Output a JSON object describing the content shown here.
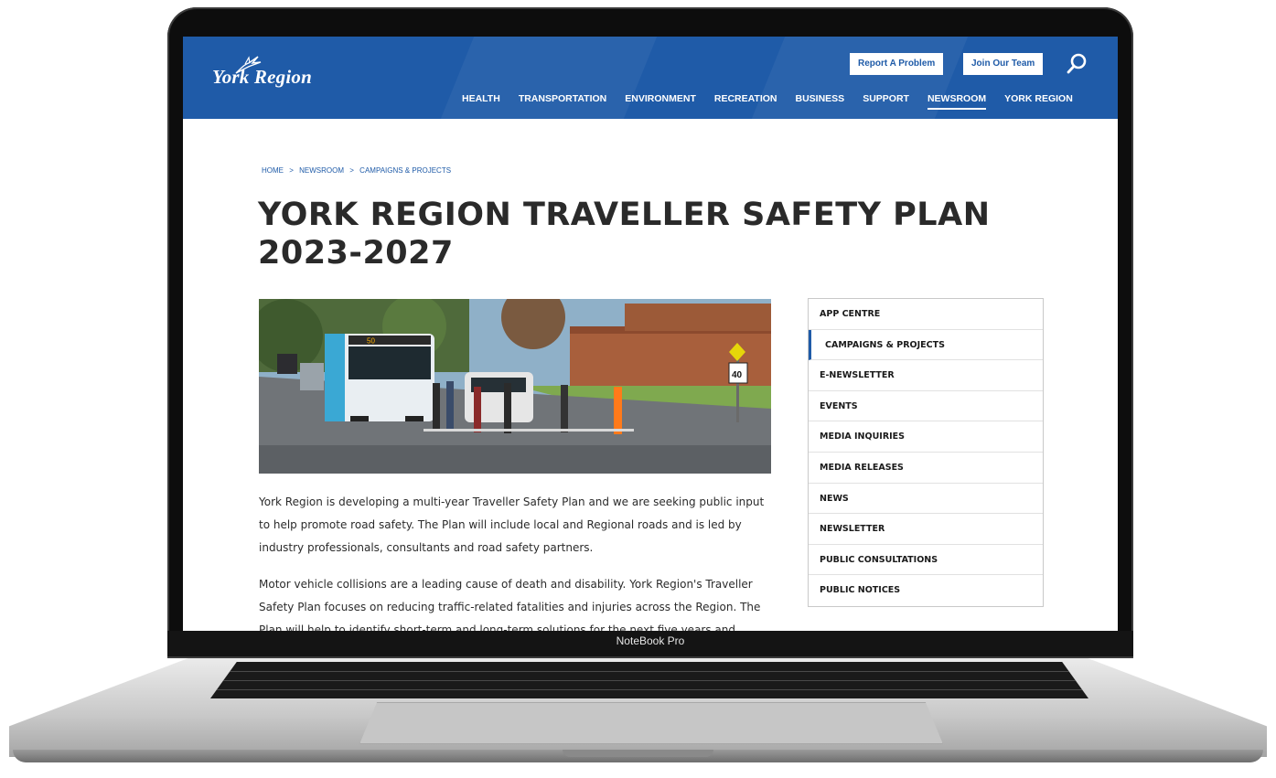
{
  "device": {
    "label": "NoteBook Pro"
  },
  "header": {
    "logo_text": "York Region",
    "utility": {
      "report": "Report A Problem",
      "join": "Join Our Team"
    },
    "nav": [
      {
        "label": "HEALTH"
      },
      {
        "label": "TRANSPORTATION"
      },
      {
        "label": "ENVIRONMENT"
      },
      {
        "label": "RECREATION"
      },
      {
        "label": "BUSINESS"
      },
      {
        "label": "SUPPORT"
      },
      {
        "label": "NEWSROOM",
        "active": true
      },
      {
        "label": "YORK REGION"
      }
    ]
  },
  "breadcrumb": {
    "home": "HOME",
    "newsroom": "NEWSROOM",
    "current": "CAMPAIGNS & PROJECTS",
    "separator": ">"
  },
  "page": {
    "title_line1": "YORK REGION TRAVELLER SAFETY PLAN",
    "title_line2": "2023-2027",
    "paragraph1": "York Region is developing a multi-year Traveller Safety Plan and we are seeking public input to help promote road safety. The Plan will include local and Regional roads and is led by industry professionals, consultants and road safety partners.",
    "paragraph2": "Motor vehicle collisions are a leading cause of death and disability. York Region's Traveller Safety Plan focuses on reducing traffic-related fatalities and injuries across the Region. The Plan will help to identify short-term and long-term solutions for the next five years and"
  },
  "hero": {
    "bus_route": "50",
    "speed_limit": "40"
  },
  "sidebar": {
    "items": [
      {
        "label": "APP CENTRE"
      },
      {
        "label": "CAMPAIGNS & PROJECTS",
        "active": true
      },
      {
        "label": "E-NEWSLETTER"
      },
      {
        "label": "EVENTS"
      },
      {
        "label": "MEDIA INQUIRIES"
      },
      {
        "label": "MEDIA RELEASES"
      },
      {
        "label": "NEWS"
      },
      {
        "label": "NEWSLETTER"
      },
      {
        "label": "PUBLIC CONSULTATIONS"
      },
      {
        "label": "PUBLIC NOTICES"
      }
    ]
  },
  "colors": {
    "brand": "#1f5ba8",
    "text": "#2a2a2a"
  },
  "icons": {
    "search": "search-icon",
    "logo": "york-region-bird-icon"
  }
}
